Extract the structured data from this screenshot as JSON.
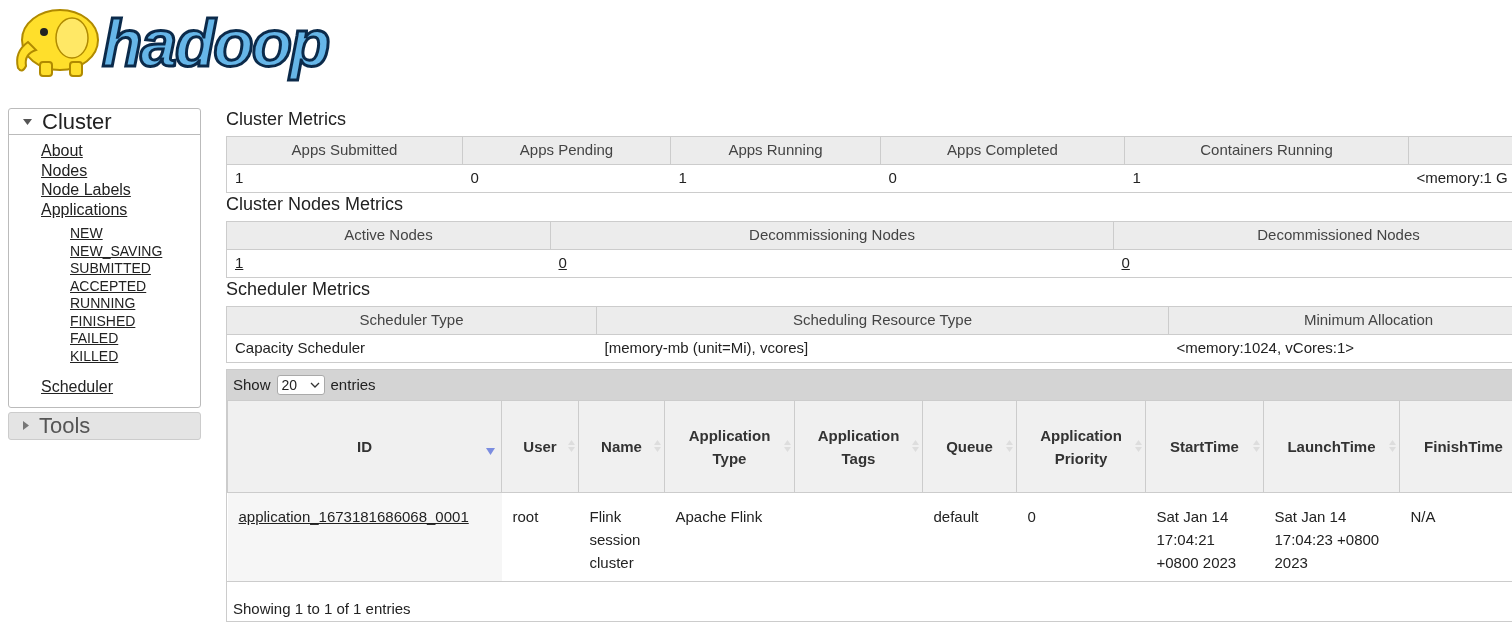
{
  "logo": {
    "text": "hadoop"
  },
  "sidebar": [
    {
      "title": "Cluster",
      "expanded": true,
      "items": [
        {
          "label": "About"
        },
        {
          "label": "Nodes"
        },
        {
          "label": "Node Labels"
        },
        {
          "label": "Applications",
          "children": [
            {
              "label": "NEW"
            },
            {
              "label": "NEW_SAVING"
            },
            {
              "label": "SUBMITTED"
            },
            {
              "label": "ACCEPTED"
            },
            {
              "label": "RUNNING"
            },
            {
              "label": "FINISHED"
            },
            {
              "label": "FAILED"
            },
            {
              "label": "KILLED"
            }
          ]
        },
        {
          "label": "Scheduler"
        }
      ]
    },
    {
      "title": "Tools",
      "expanded": false
    }
  ],
  "sections": [
    {
      "title": "Cluster Metrics",
      "columns": [
        "Apps Submitted",
        "Apps Pending",
        "Apps Running",
        "Apps Completed",
        "Containers Running",
        ""
      ],
      "values": [
        {
          "text": "1",
          "link": false
        },
        {
          "text": "0",
          "link": false
        },
        {
          "text": "1",
          "link": false
        },
        {
          "text": "0",
          "link": false
        },
        {
          "text": "1",
          "link": false
        },
        {
          "text": "<memory:1 G",
          "link": false
        }
      ]
    },
    {
      "title": "Cluster Nodes Metrics",
      "columns": [
        "Active Nodes",
        "Decommissioning Nodes",
        "Decommissioned Nodes"
      ],
      "values": [
        {
          "text": "1",
          "link": true
        },
        {
          "text": "0",
          "link": true
        },
        {
          "text": "0",
          "link": true
        }
      ]
    },
    {
      "title": "Scheduler Metrics",
      "columns": [
        "Scheduler Type",
        "Scheduling Resource Type",
        "Minimum Allocation"
      ],
      "values": [
        {
          "text": "Capacity Scheduler",
          "link": false
        },
        {
          "text": "[memory-mb (unit=Mi), vcores]",
          "link": false
        },
        {
          "text": "<memory:1024, vCores:1>",
          "link": false
        }
      ]
    }
  ],
  "apps": {
    "show_label": "Show",
    "page_size": "20",
    "entries_label": "entries",
    "columns": [
      {
        "label": "ID",
        "sorted": true
      },
      {
        "label": "User",
        "sorted": false
      },
      {
        "label": "Name",
        "sorted": false
      },
      {
        "label": "Application Type",
        "sorted": false
      },
      {
        "label": "Application Tags",
        "sorted": false
      },
      {
        "label": "Queue",
        "sorted": false
      },
      {
        "label": "Application Priority",
        "sorted": false
      },
      {
        "label": "StartTime",
        "sorted": false
      },
      {
        "label": "LaunchTime",
        "sorted": false
      },
      {
        "label": "FinishTime"
      }
    ],
    "rows": [
      [
        "application_1673181686068_0001",
        "root",
        "Flink session cluster",
        "Apache Flink",
        "",
        "default",
        "0",
        "Sat Jan 14 17:04:21 +0800 2023",
        "Sat Jan 14 17:04:23 +0800 2023",
        "N/A"
      ]
    ],
    "footer": "Showing 1 to 1 of 1 entries"
  }
}
